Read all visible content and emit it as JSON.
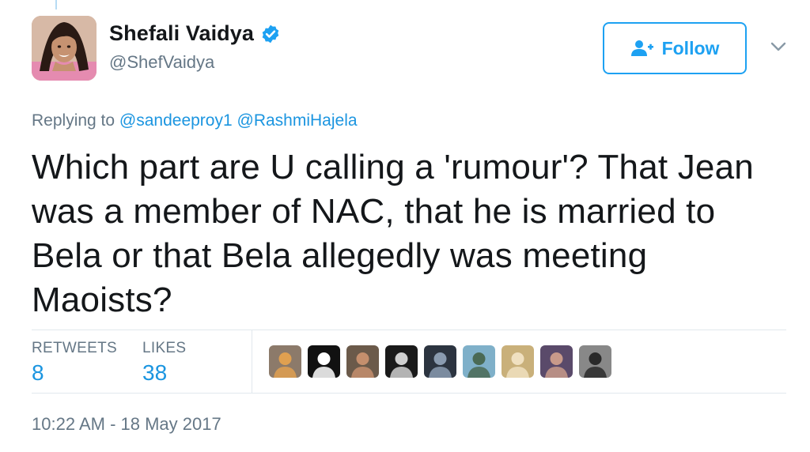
{
  "thread": {},
  "author": {
    "display_name": "Shefali Vaidya",
    "handle": "@ShefVaidya",
    "verified_icon": "verified-badge-icon",
    "avatar_icon": "profile-photo"
  },
  "follow_button": {
    "label": "Follow",
    "icon": "add-user-icon"
  },
  "menu": {
    "icon": "chevron-down-icon"
  },
  "reply": {
    "prefix": "Replying to",
    "mentions": [
      "@sandeeproy1",
      "@RashmiHajela"
    ]
  },
  "tweet": {
    "text": "Which part are U calling a 'rumour'? That Jean was a member of NAC, that he is married to Bela or that Bela allegedly was meeting Maoists?"
  },
  "stats": {
    "retweets_label": "RETWEETS",
    "retweets_value": "8",
    "likes_label": "LIKES",
    "likes_value": "38"
  },
  "likers": [
    {
      "name": "liker-1",
      "bg": "#8c7a6a",
      "fg": "#e0a050"
    },
    {
      "name": "liker-2",
      "bg": "#111111",
      "fg": "#ffffff"
    },
    {
      "name": "liker-3",
      "bg": "#6b5a4a",
      "fg": "#c58f6d"
    },
    {
      "name": "liker-4",
      "bg": "#1a1a1a",
      "fg": "#cfcfcf"
    },
    {
      "name": "liker-5",
      "bg": "#2c3440",
      "fg": "#8a9bb0"
    },
    {
      "name": "liker-6",
      "bg": "#7fb0c9",
      "fg": "#4a6a55"
    },
    {
      "name": "liker-7",
      "bg": "#c9b07a",
      "fg": "#f0e0c0"
    },
    {
      "name": "liker-8",
      "bg": "#5a4a6a",
      "fg": "#c89a8a"
    },
    {
      "name": "liker-9",
      "bg": "#888888",
      "fg": "#2a2a2a"
    }
  ],
  "timestamp": "10:22 AM - 18 May 2017",
  "colors": {
    "accent": "#1da1f2",
    "link": "#1b95e0",
    "muted": "#657786",
    "text": "#14171a",
    "divider": "#e1e8ed"
  }
}
